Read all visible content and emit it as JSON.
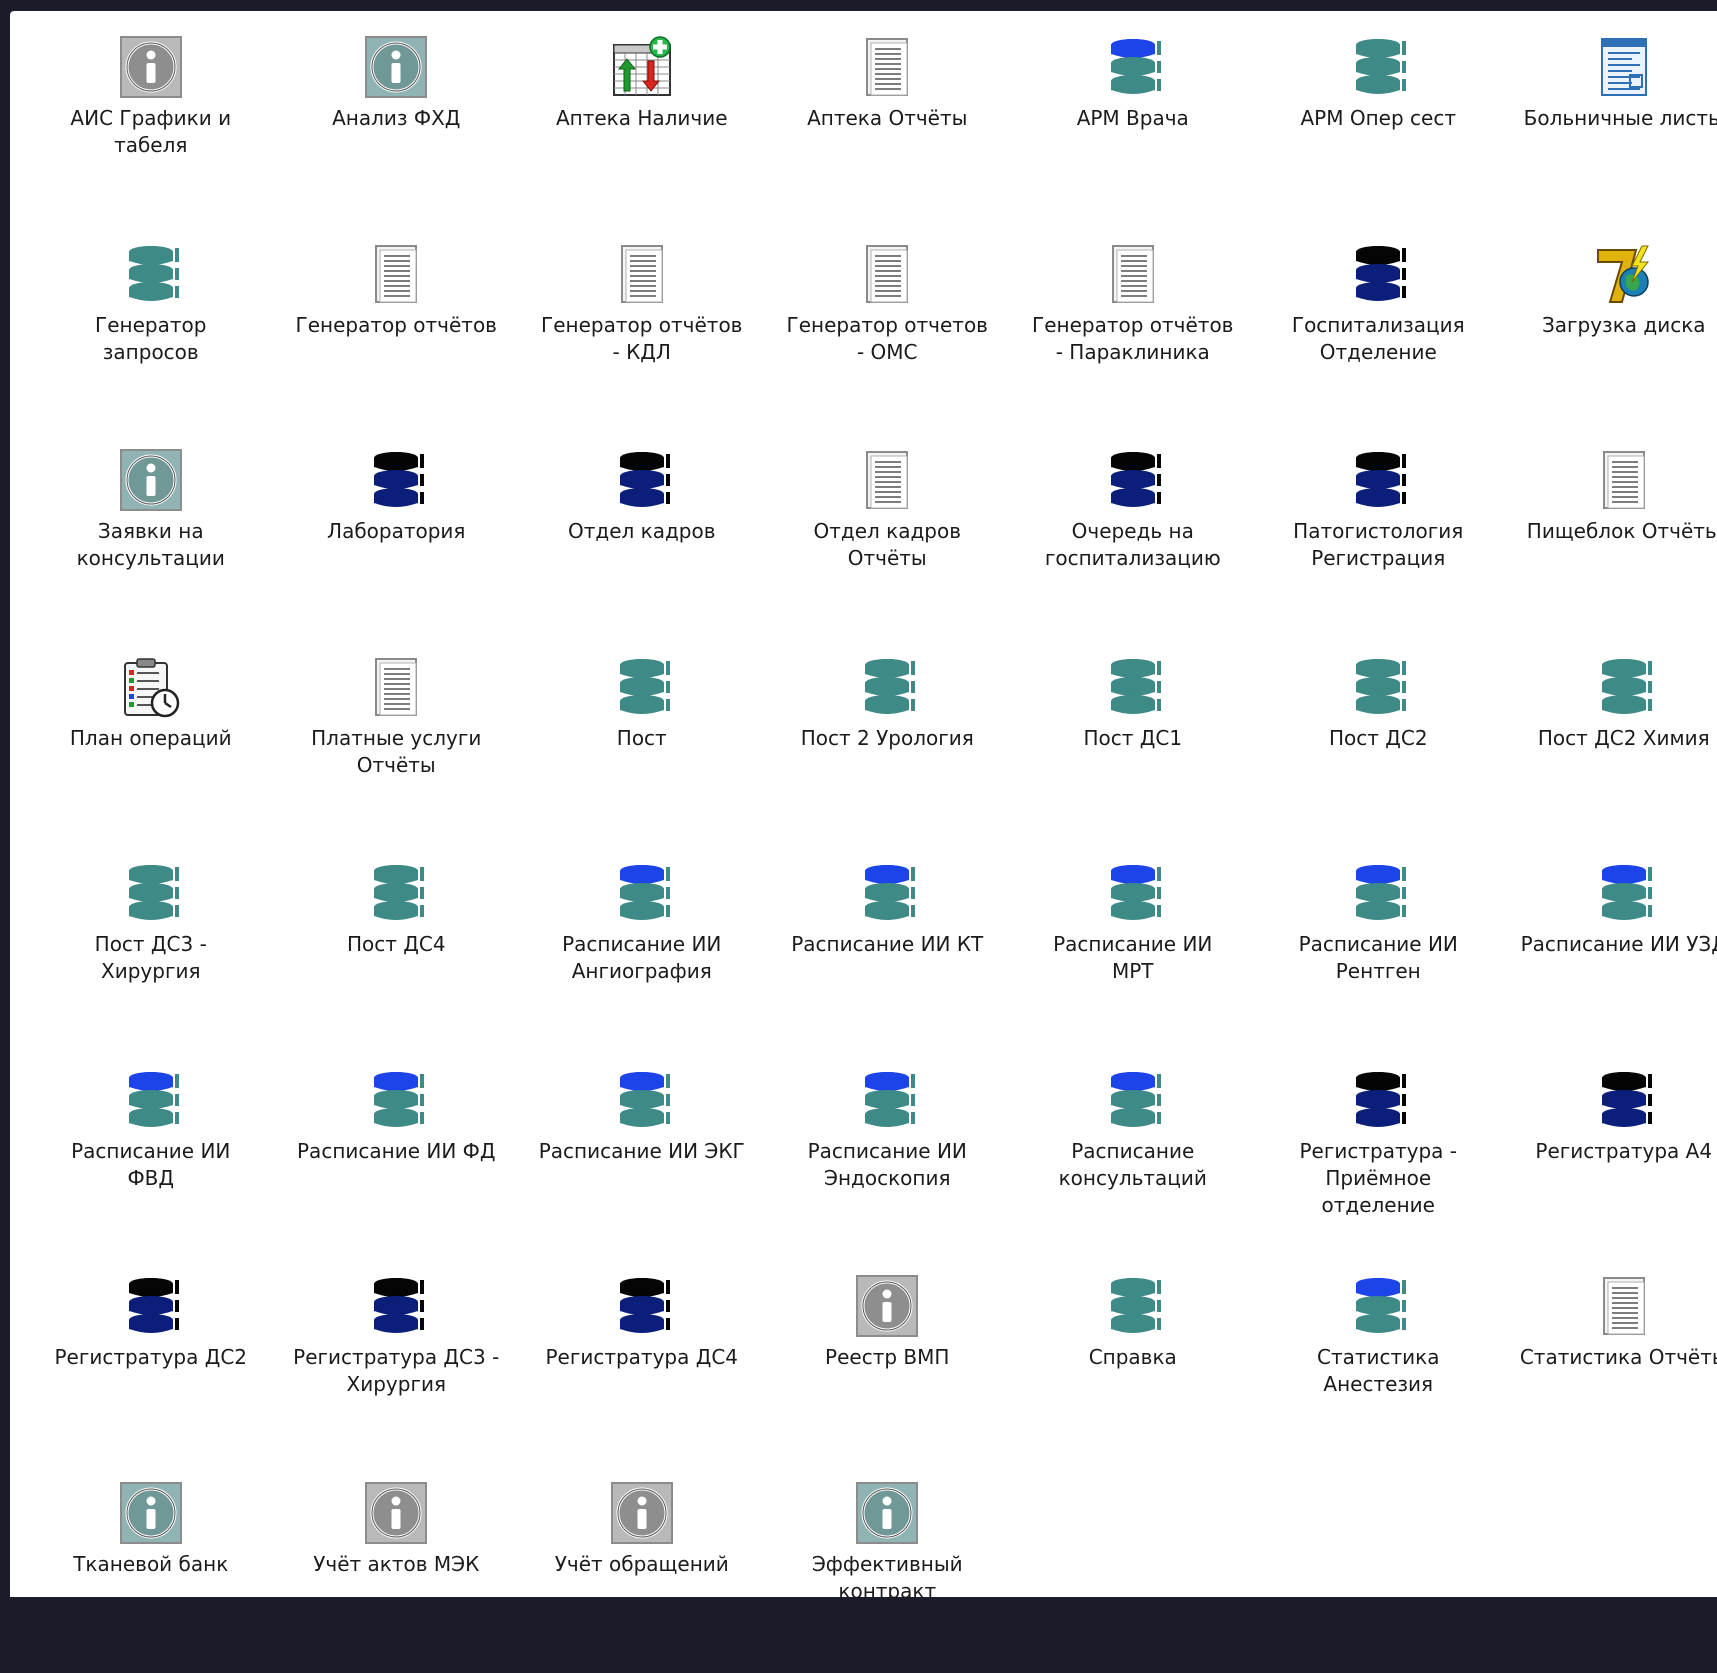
{
  "colors": {
    "desktop_bg": "#1b1c2a",
    "panel_bg": "#ffffff",
    "label_text": "#1b1b1b",
    "db_teal": "#3d8a87",
    "db_blue": "#1c44e8",
    "db_navy": "#0b1f7a",
    "db_black": "#050505"
  },
  "items": [
    {
      "label": "АИС Графики и\nтабеля",
      "icon": "info-grey-icon"
    },
    {
      "label": "Анализ ФХД",
      "icon": "info-teal-icon"
    },
    {
      "label": "Аптека Наличие",
      "icon": "pharmacy-spreadsheet-icon"
    },
    {
      "label": "Аптека Отчёты",
      "icon": "document-report-icon"
    },
    {
      "label": "АРМ Врача",
      "icon": "database-blue-icon"
    },
    {
      "label": "АРМ Опер сест",
      "icon": "database-teal-icon"
    },
    {
      "label": "Больничные листы",
      "icon": "document-form-icon"
    },
    {
      "label": "Генератор\nзапросов",
      "icon": "database-teal-icon"
    },
    {
      "label": "Генератор отчётов",
      "icon": "document-report-icon"
    },
    {
      "label": "Генератор отчётов\n- КДЛ",
      "icon": "document-report-icon"
    },
    {
      "label": "Генератор отчетов\n- ОМС",
      "icon": "document-report-icon"
    },
    {
      "label": "Генератор отчётов\n- Параклиника",
      "icon": "document-report-icon"
    },
    {
      "label": "Госпитализация\nОтделение",
      "icon": "database-black-icon"
    },
    {
      "label": "Загрузка диска",
      "icon": "delphi7-icon"
    },
    {
      "label": "Заявки на\nконсультации",
      "icon": "info-teal-icon"
    },
    {
      "label": "Лаборатория",
      "icon": "database-black-icon"
    },
    {
      "label": "Отдел кадров",
      "icon": "database-black-icon"
    },
    {
      "label": "Отдел кадров\nОтчёты",
      "icon": "document-report-icon"
    },
    {
      "label": "Очередь на\nгоспитализацию",
      "icon": "database-black-icon"
    },
    {
      "label": "Патогистология\nРегистрация",
      "icon": "database-black-icon"
    },
    {
      "label": "Пищеблок Отчёты",
      "icon": "document-report-icon"
    },
    {
      "label": "План операций",
      "icon": "clipboard-clock-icon"
    },
    {
      "label": "Платные услуги\nОтчёты",
      "icon": "document-report-icon"
    },
    {
      "label": "Пост",
      "icon": "database-teal-icon"
    },
    {
      "label": "Пост 2 Урология",
      "icon": "database-teal-icon"
    },
    {
      "label": "Пост ДС1",
      "icon": "database-teal-icon"
    },
    {
      "label": "Пост ДС2",
      "icon": "database-teal-icon"
    },
    {
      "label": "Пост ДС2 Химия",
      "icon": "database-teal-icon"
    },
    {
      "label": "Пост ДС3 -\nХирургия",
      "icon": "database-teal-icon"
    },
    {
      "label": "Пост ДС4",
      "icon": "database-teal-icon"
    },
    {
      "label": "Расписание ИИ\nАнгиография",
      "icon": "database-blue-icon"
    },
    {
      "label": "Расписание ИИ КТ",
      "icon": "database-blue-icon"
    },
    {
      "label": "Расписание ИИ\nМРТ",
      "icon": "database-blue-icon"
    },
    {
      "label": "Расписание ИИ\nРентген",
      "icon": "database-blue-icon"
    },
    {
      "label": "Расписание ИИ УЗД",
      "icon": "database-blue-icon"
    },
    {
      "label": "Расписание ИИ\nФВД",
      "icon": "database-blue-icon"
    },
    {
      "label": "Расписание ИИ ФД",
      "icon": "database-blue-icon"
    },
    {
      "label": "Расписание ИИ ЭКГ",
      "icon": "database-blue-icon"
    },
    {
      "label": "Расписание ИИ\nЭндоскопия",
      "icon": "database-blue-icon"
    },
    {
      "label": "Расписание\nконсультаций",
      "icon": "database-blue-icon"
    },
    {
      "label": "Регистратура -\nПриёмное\nотделение",
      "icon": "database-black-icon"
    },
    {
      "label": "Регистратура А4",
      "icon": "database-black-icon"
    },
    {
      "label": "Регистратура ДС2",
      "icon": "database-black-icon"
    },
    {
      "label": "Регистратура ДС3 -\nХирургия",
      "icon": "database-black-icon"
    },
    {
      "label": "Регистратура ДС4",
      "icon": "database-black-icon"
    },
    {
      "label": "Реестр ВМП",
      "icon": "info-grey-icon"
    },
    {
      "label": "Справка",
      "icon": "database-teal-icon"
    },
    {
      "label": "Статистика\nАнестезия",
      "icon": "database-blue-icon"
    },
    {
      "label": "Статистика Отчёты",
      "icon": "document-report-icon"
    },
    {
      "label": "Тканевой банк",
      "icon": "info-teal-icon"
    },
    {
      "label": "Учёт актов МЭК",
      "icon": "info-grey-icon"
    },
    {
      "label": "Учёт обращений",
      "icon": "info-grey-icon"
    },
    {
      "label": "Эффективный\nконтракт",
      "icon": "info-teal-icon"
    }
  ]
}
